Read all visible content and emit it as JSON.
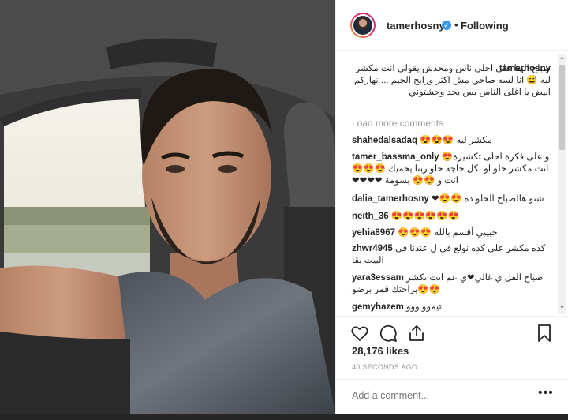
{
  "post": {
    "username": "tamerhosny",
    "verified_icon": "verified-badge-icon",
    "separator": "•",
    "follow_status": "Following"
  },
  "caption": {
    "username": "tamerhosny",
    "text": "صباح الهنا على احلى ناس ومحدش يقولي انت مكشر ليه 😅 انا لسه صاحي مش اكتر ورايح الجيم ... نهاركم ابيض يا اغلى الناس بس بجد وحشتوني"
  },
  "load_more": "Load more comments",
  "comments": [
    {
      "user": "shahedalsadaq",
      "text": "مكشر ليه 😍😍😍"
    },
    {
      "user": "tamer_bassma_only",
      "text": "و على فكرة احلى تكشيرة😍 انت مكشر حلو او بكل حاجة حلو ربنا يحميك 😍😍😍انت و 😍😍 بسومة ❤❤❤❤"
    },
    {
      "user": "dalia_tamerhosny",
      "text": "شنو هالصباح الحلو ده 😍😍❤"
    },
    {
      "user": "neith_36",
      "text": "😍😍😍😍😍😍"
    },
    {
      "user": "yehia8967",
      "text": "حبيبي أقسم بالله 😍😍😍"
    },
    {
      "user": "zhwr4945",
      "text": "كده مكشر على كده نولع في ل عندنا في البيت بقا"
    },
    {
      "user": "yara3essam",
      "text": "صباح الفل ي غالي❤ي عم انت تكشر 😍😍براحتك قمر برضو"
    },
    {
      "user": "gemyhazem",
      "text": "تيموو ووو"
    }
  ],
  "likes": "28,176 likes",
  "time_ago": "40 SECONDS AGO",
  "add_comment_placeholder": "Add a comment...",
  "more_label": "•••",
  "icons": {
    "like": "heart-icon",
    "comment": "comment-icon",
    "share": "share-icon",
    "save": "bookmark-icon"
  },
  "colors": {
    "verified": "#3897f0",
    "muted": "#999999",
    "text": "#262626"
  }
}
